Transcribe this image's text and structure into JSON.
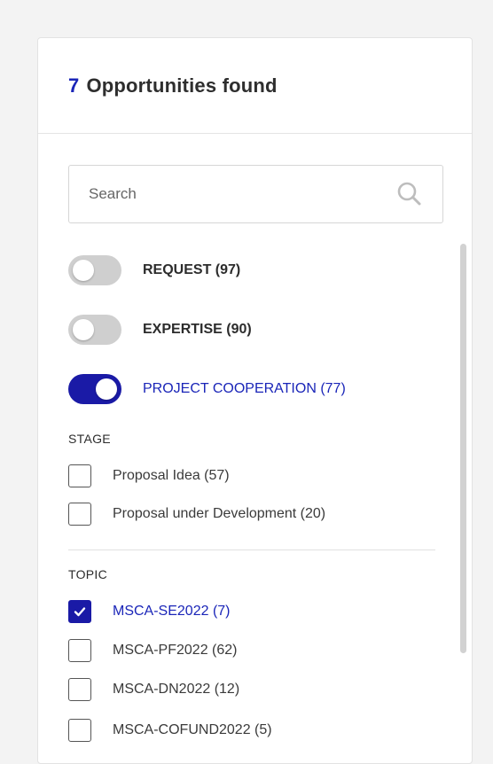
{
  "header": {
    "count": "7",
    "title": "Opportunities found"
  },
  "search": {
    "placeholder": "Search"
  },
  "toggles": [
    {
      "label": "REQUEST (97)",
      "on": false
    },
    {
      "label": "EXPERTISE (90)",
      "on": false
    },
    {
      "label": "PROJECT COOPERATION (77)",
      "on": true
    }
  ],
  "stage": {
    "title": "STAGE",
    "items": [
      {
        "label": "Proposal Idea (57)",
        "checked": false
      },
      {
        "label": "Proposal under Development (20)",
        "checked": false
      }
    ]
  },
  "topic": {
    "title": "TOPIC",
    "items": [
      {
        "label": "MSCA-SE2022 (7)",
        "checked": true
      },
      {
        "label": "MSCA-PF2022 (62)",
        "checked": false
      },
      {
        "label": "MSCA-DN2022 (12)",
        "checked": false
      },
      {
        "label": "MSCA-COFUND2022 (5)",
        "checked": false
      }
    ]
  },
  "colors": {
    "accent": "#1a25b8",
    "toggle_on": "#1a1aa6",
    "toggle_off": "#cfcfcf"
  }
}
